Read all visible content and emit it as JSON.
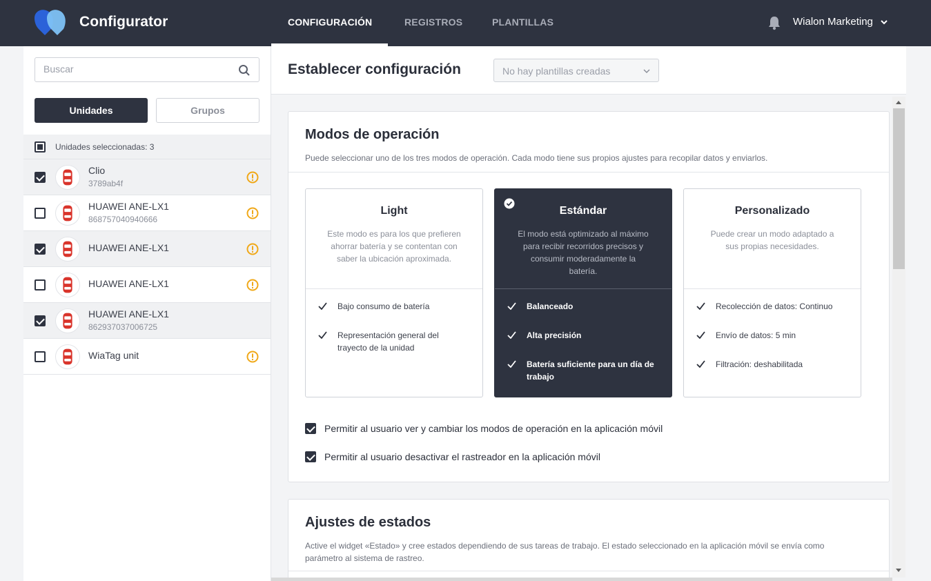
{
  "header": {
    "app_title": "Configurator",
    "tabs": [
      {
        "label": "CONFIGURACIÓN",
        "active": true
      },
      {
        "label": "REGISTROS",
        "active": false
      },
      {
        "label": "PLANTILLAS",
        "active": false
      }
    ],
    "user_name": "Wialon Marketing",
    "icons": {
      "logo": "heart-logo-icon",
      "bell": "bell-icon",
      "user_menu": "chevron-down-icon"
    }
  },
  "sidebar": {
    "search_placeholder": "Buscar",
    "segments": [
      {
        "label": "Unidades",
        "active": true
      },
      {
        "label": "Grupos",
        "active": false
      }
    ],
    "selected_summary": "Unidades seleccionadas: 3",
    "units": [
      {
        "name": "Clio",
        "id": "3789ab4f",
        "checked": true,
        "warning": true
      },
      {
        "name": "HUAWEI ANE-LX1",
        "id": "868757040940666",
        "checked": false,
        "warning": true
      },
      {
        "name": "HUAWEI ANE-LX1",
        "id": "",
        "checked": true,
        "warning": true
      },
      {
        "name": "HUAWEI ANE-LX1",
        "id": "",
        "checked": false,
        "warning": true
      },
      {
        "name": "HUAWEI ANE-LX1",
        "id": "862937037006725",
        "checked": true,
        "warning": false
      },
      {
        "name": "WiaTag unit",
        "id": "",
        "checked": false,
        "warning": true
      }
    ]
  },
  "main": {
    "page_title": "Establecer configuración",
    "template_select_value": "No hay plantillas creadas",
    "modes_card": {
      "title": "Modos de operación",
      "description": "Puede seleccionar uno de los tres modos de operación. Cada modo tiene sus propios ajustes para recopilar datos y enviarlos.",
      "modes": [
        {
          "title": "Light",
          "desc_lines": [
            "Este modo es para los que prefieren",
            "ahorrar batería y se contentan con",
            "saber la ubicación aproximada."
          ],
          "features": [
            {
              "lines": [
                "Bajo consumo de batería"
              ]
            },
            {
              "lines": [
                "Representación general del",
                "trayecto de la unidad"
              ]
            }
          ],
          "active": false
        },
        {
          "title": "Estándar",
          "desc_lines": [
            "El modo está optimizado al máximo",
            "para recibir recorridos precisos y",
            "consumir moderadamente la",
            "batería."
          ],
          "features": [
            {
              "lines": [
                "Balanceado"
              ]
            },
            {
              "lines": [
                "Alta precisión"
              ]
            },
            {
              "lines": [
                "Batería suficiente para un día de",
                "trabajo"
              ]
            }
          ],
          "active": true
        },
        {
          "title": "Personalizado",
          "desc_lines": [
            "Puede crear un modo adaptado a",
            "sus propias necesidades."
          ],
          "features": [
            {
              "lines": [
                "Recolección de datos: Continuo"
              ]
            },
            {
              "lines": [
                "Envío de datos: 5 min"
              ]
            },
            {
              "lines": [
                "Filtración: deshabilitada"
              ]
            }
          ],
          "active": false
        }
      ],
      "permissions": [
        {
          "label": "Permitir al usuario ver y cambiar los modos de operación en la aplicación móvil",
          "checked": true
        },
        {
          "label": "Permitir al usuario desactivar el rastreador en la aplicación móvil",
          "checked": true
        }
      ]
    },
    "states_card": {
      "title": "Ajustes de estados",
      "description_lines": [
        "Active el widget «Estado» y cree estados dependiendo de sus tareas de trabajo. El estado seleccionado en la aplicación móvil se envía como",
        "parámetro al sistema de rastreo."
      ]
    }
  },
  "colors": {
    "header_bg": "#2e3340",
    "accent_blue": "#4a8fe8",
    "warning": "#f0a818",
    "active_card": "#2e3340"
  }
}
